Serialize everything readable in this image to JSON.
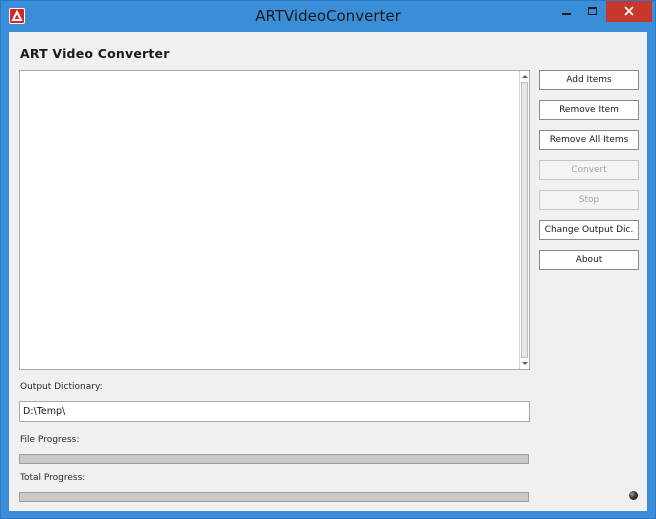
{
  "window": {
    "title": "ARTVideoConverter",
    "controls": {
      "minimize_icon": "minimize-icon",
      "maximize_icon": "maximize-icon",
      "close_icon": "close-icon"
    }
  },
  "main": {
    "heading": "ART Video Converter",
    "items": []
  },
  "buttons": [
    {
      "label": "Add Items",
      "enabled": true
    },
    {
      "label": "Remove Item",
      "enabled": true
    },
    {
      "label": "Remove All Items",
      "enabled": true
    },
    {
      "label": "Convert",
      "enabled": false
    },
    {
      "label": "Stop",
      "enabled": false
    },
    {
      "label": "Change Output Dic.",
      "enabled": true
    },
    {
      "label": "About",
      "enabled": true
    }
  ],
  "output": {
    "label": "Output Dictionary:",
    "value": "D:\\Temp\\"
  },
  "file_progress": {
    "label": "File Progress:",
    "fraction": 0
  },
  "total_progress": {
    "label": "Total Progress:",
    "fraction": 0
  },
  "colors": {
    "titlebar": "#3a8ed8",
    "close_button": "#c7382c",
    "client_bg": "#f0f0f0"
  }
}
